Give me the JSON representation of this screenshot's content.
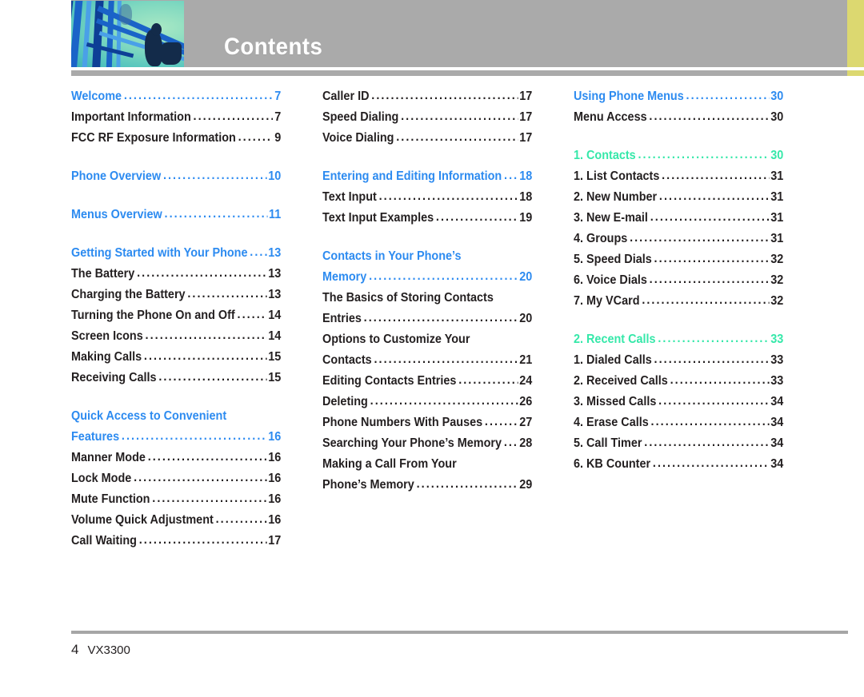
{
  "header": {
    "title": "Contents",
    "band_color": "#aaaaaa",
    "accent_color": "#dcd870",
    "photo_alt": "abstract-teal-blue-photo"
  },
  "colors": {
    "section_blue": "#2d8bf0",
    "section_green": "#35e8a9",
    "body_black": "#231f20"
  },
  "leader": "......................................................",
  "columns": [
    {
      "id": "column-1",
      "entries": [
        {
          "label": "Welcome",
          "page": "7",
          "style": "sec"
        },
        {
          "label": "Important Information",
          "page": "7",
          "style": "sub"
        },
        {
          "label": "FCC RF Exposure Information",
          "page": "9",
          "style": "sub"
        },
        {
          "label": "",
          "page": "",
          "style": "gap"
        },
        {
          "label": "Phone Overview",
          "page": "10",
          "style": "sec"
        },
        {
          "label": "",
          "page": "",
          "style": "gap"
        },
        {
          "label": "Menus Overview",
          "page": "11",
          "style": "sec"
        },
        {
          "label": "",
          "page": "",
          "style": "gap"
        },
        {
          "label": "Getting Started with Your Phone",
          "page": "13",
          "style": "sec"
        },
        {
          "label": "The Battery",
          "page": "13",
          "style": "sub"
        },
        {
          "label": "Charging the Battery",
          "page": "13",
          "style": "sub"
        },
        {
          "label": "Turning the Phone On and Off",
          "page": "14",
          "style": "sub"
        },
        {
          "label": "Screen Icons",
          "page": "14",
          "style": "sub"
        },
        {
          "label": "Making Calls",
          "page": "15",
          "style": "sub"
        },
        {
          "label": "Receiving Calls",
          "page": "15",
          "style": "sub"
        },
        {
          "label": "",
          "page": "",
          "style": "gap"
        },
        {
          "label": "Quick Access to Convenient",
          "page": "",
          "style": "sec-cont"
        },
        {
          "label": "Features",
          "page": "16",
          "style": "sec"
        },
        {
          "label": "Manner Mode",
          "page": "16",
          "style": "sub"
        },
        {
          "label": "Lock Mode",
          "page": "16",
          "style": "sub"
        },
        {
          "label": "Mute Function",
          "page": "16",
          "style": "sub"
        },
        {
          "label": "Volume Quick Adjustment",
          "page": "16",
          "style": "sub"
        },
        {
          "label": "Call Waiting",
          "page": "17",
          "style": "sub"
        }
      ]
    },
    {
      "id": "column-2",
      "entries": [
        {
          "label": "Caller ID",
          "page": "17",
          "style": "sub"
        },
        {
          "label": "Speed Dialing",
          "page": "17",
          "style": "sub"
        },
        {
          "label": "Voice Dialing",
          "page": "17",
          "style": "sub"
        },
        {
          "label": "",
          "page": "",
          "style": "gap"
        },
        {
          "label": "Entering and Editing Information",
          "page": "18",
          "style": "sec"
        },
        {
          "label": "Text Input",
          "page": "18",
          "style": "sub"
        },
        {
          "label": "Text Input Examples",
          "page": "19",
          "style": "sub"
        },
        {
          "label": "",
          "page": "",
          "style": "gap"
        },
        {
          "label": "Contacts in Your Phone’s",
          "page": "",
          "style": "sec-cont"
        },
        {
          "label": "Memory",
          "page": "20",
          "style": "sec"
        },
        {
          "label": "The Basics of Storing Contacts",
          "page": "",
          "style": "sub-cont"
        },
        {
          "label": "Entries",
          "page": "20",
          "style": "sub"
        },
        {
          "label": "Options to Customize Your",
          "page": "",
          "style": "sub-cont"
        },
        {
          "label": "Contacts",
          "page": "21",
          "style": "sub"
        },
        {
          "label": "Editing Contacts Entries",
          "page": "24",
          "style": "sub"
        },
        {
          "label": "Deleting",
          "page": "26",
          "style": "sub"
        },
        {
          "label": "Phone Numbers With Pauses",
          "page": "27",
          "style": "sub"
        },
        {
          "label": "Searching Your Phone’s Memory",
          "page": "28",
          "style": "sub"
        },
        {
          "label": "Making a Call From Your",
          "page": "",
          "style": "sub-cont"
        },
        {
          "label": "Phone’s Memory",
          "page": "29",
          "style": "sub"
        }
      ]
    },
    {
      "id": "column-3",
      "entries": [
        {
          "label": "Using Phone Menus",
          "page": "30",
          "style": "sec"
        },
        {
          "label": "Menu Access",
          "page": "30",
          "style": "sub"
        },
        {
          "label": "",
          "page": "",
          "style": "gap"
        },
        {
          "label": "1. Contacts",
          "page": "30",
          "style": "sec-green"
        },
        {
          "label": "1. List Contacts",
          "page": "31",
          "style": "sub"
        },
        {
          "label": "2. New Number",
          "page": "31",
          "style": "sub"
        },
        {
          "label": "3. New E-mail",
          "page": "31",
          "style": "sub"
        },
        {
          "label": "4. Groups",
          "page": "31",
          "style": "sub"
        },
        {
          "label": "5. Speed Dials",
          "page": "32",
          "style": "sub"
        },
        {
          "label": "6. Voice Dials",
          "page": "32",
          "style": "sub"
        },
        {
          "label": "7. My VCard",
          "page": "32",
          "style": "sub"
        },
        {
          "label": "",
          "page": "",
          "style": "gap"
        },
        {
          "label": "2. Recent Calls",
          "page": "33",
          "style": "sec-green"
        },
        {
          "label": "1. Dialed Calls",
          "page": "33",
          "style": "sub"
        },
        {
          "label": "2. Received Calls",
          "page": "33",
          "style": "sub"
        },
        {
          "label": "3. Missed Calls",
          "page": "34",
          "style": "sub"
        },
        {
          "label": "4. Erase Calls",
          "page": "34",
          "style": "sub"
        },
        {
          "label": "5. Call Timer",
          "page": "34",
          "style": "sub"
        },
        {
          "label": "6. KB Counter",
          "page": "34",
          "style": "sub"
        }
      ]
    }
  ],
  "footer": {
    "page_number": "4",
    "model": "VX3300"
  }
}
